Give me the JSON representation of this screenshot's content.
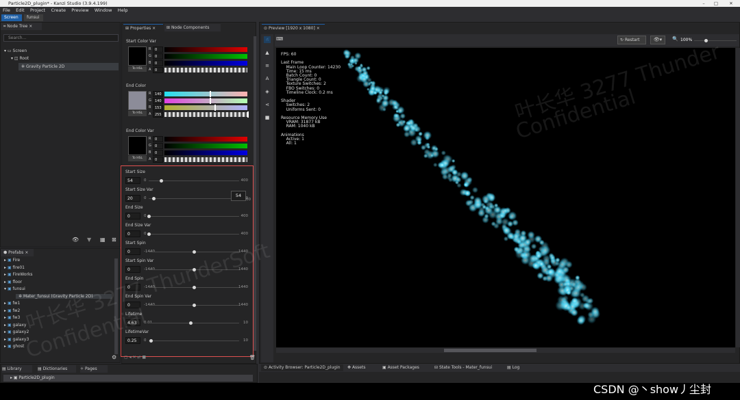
{
  "window": {
    "title": "Particle2D_plugin* - Kanzi Studio (3.9.4.199)"
  },
  "menu": [
    "File",
    "Edit",
    "Project",
    "Create",
    "Preview",
    "Window",
    "Help"
  ],
  "tabs": [
    {
      "label": "Screen"
    },
    {
      "label": "funsui"
    }
  ],
  "node_tree": {
    "title": "Node Tree",
    "search_placeholder": "Search...",
    "items": [
      "Screen",
      "Root",
      "Gravity Particle 2D"
    ]
  },
  "prefabs": {
    "title": "Prefabs",
    "items": [
      "Fire",
      "fire01",
      "FireWorks",
      "floor",
      "funsui",
      "Mater_funsui (Gravity Particle 2D)",
      "fw1",
      "fw2",
      "fw3",
      "galaxy",
      "galaxy2",
      "galaxy3",
      "ghost"
    ]
  },
  "properties": {
    "tab": "Properties",
    "tab2": "Node Components",
    "to_hsl": "To HSL",
    "start_color_var": {
      "label": "Start Color Var",
      "r": "0",
      "g": "0",
      "b": "0",
      "a": "0",
      "swatch": "#000000"
    },
    "end_color": {
      "label": "End Color",
      "r": "140",
      "g": "140",
      "b": "153",
      "a": "255",
      "swatch": "#8c8c99"
    },
    "end_color_var": {
      "label": "End Color Var",
      "r": "0",
      "g": "0",
      "b": "0",
      "a": "0",
      "swatch": "#000000"
    },
    "channel_letters": [
      "R",
      "G",
      "B",
      "A"
    ],
    "sliders": [
      {
        "label": "Start Size",
        "value": "54",
        "min": "0",
        "max": "400",
        "pos": 0.135
      },
      {
        "label": "Start Size Var",
        "value": "20",
        "min": "0",
        "max": "400",
        "pos": 0.05
      },
      {
        "label": "End Size",
        "value": "0",
        "min": "0",
        "max": "400",
        "pos": 0
      },
      {
        "label": "End Size Var",
        "value": "0",
        "min": "0",
        "max": "400",
        "pos": 0
      },
      {
        "label": "Start Spin",
        "value": "0",
        "min": "-1440",
        "max": "1440",
        "pos": 0.5
      },
      {
        "label": "Start Spin Var",
        "value": "0",
        "min": "-1440",
        "max": "1440",
        "pos": 0.5
      },
      {
        "label": "End Spin",
        "value": "0",
        "min": "-1440",
        "max": "1440",
        "pos": 0.5
      },
      {
        "label": "End Spin Var",
        "value": "0",
        "min": "-1440",
        "max": "1440",
        "pos": 0.5
      },
      {
        "label": "Lifetime",
        "value": "4.63",
        "min": "0.01",
        "max": "10",
        "pos": 0.462
      },
      {
        "label": "LifetimeVar",
        "value": "0.25",
        "min": "0",
        "max": "10",
        "pos": 0.025
      }
    ],
    "tooltip": "54",
    "tooltip_tail": "00"
  },
  "preview": {
    "tab": "Preview [1920 x 1080]",
    "restart": "Restart",
    "zoom": "100%",
    "stats": "FPS: 60\n\nLast Frame\n    Main Loop Counter: 14230\n    Time: 15 ms\n    Batch Count: 0\n    Triangle Count: 0\n    Texture Switches: 2\n    FBO Switches: 0\n    Timeline Clock: 0.2 ms\n\nShader\n    Switches: 2\n    Uniforms Sent: 0\n\nResource Memory Use\n    VRAM: 31877 kB\n    RAM: 1040 kB\n\nAnimations\n    Active: 1\n    All: 1"
  },
  "bottom_tabs_left": [
    "Library",
    "Dictionaries",
    "Pages"
  ],
  "library_item": "Particle2D_plugin",
  "bottom_tabs_right": [
    "Activity Browser: Particle2D_plugin",
    "Assets",
    "Asset Packages",
    "State Tools - Mater_funsui",
    "Log"
  ],
  "watermarks": [
    "叶长华 3277 Thunder",
    "Confidential",
    "叶长华 3277 ThunderSoft",
    "Confidential"
  ],
  "credit": "CSDN @丶show丿尘封",
  "colors": {
    "accent": "#1f5fa5",
    "highlight_border": "#e05050",
    "particle": "#5fe4ff"
  }
}
